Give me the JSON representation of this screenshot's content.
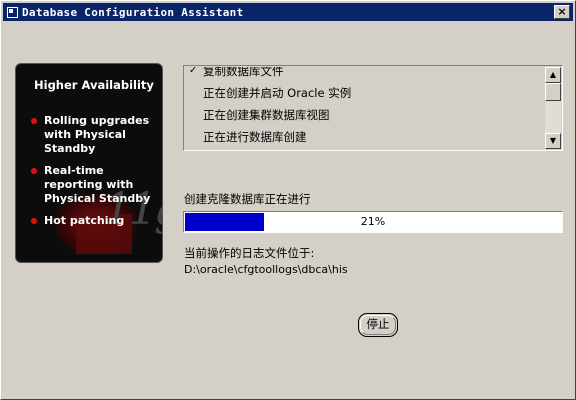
{
  "window": {
    "title": "Database Configuration Assistant",
    "close_glyph": "×"
  },
  "promo": {
    "title": "Higher Availability",
    "items": [
      "Rolling upgrades with Physical Standby",
      "Real-time reporting with Physical Standby",
      "Hot patching"
    ],
    "watermark": "11g"
  },
  "steps": {
    "items": [
      {
        "label": "复制数据库文件",
        "status": "completed",
        "check": "✓"
      },
      {
        "label": "正在创建并启动 Oracle 实例",
        "status": "pending"
      },
      {
        "label": "正在创建集群数据库视图",
        "status": "pending"
      },
      {
        "label": "正在进行数据库创建",
        "status": "pending"
      }
    ]
  },
  "progress": {
    "label": "创建克隆数据库正在进行",
    "percent": 21,
    "percent_text": "21%",
    "fill_color": "#0000cc"
  },
  "log": {
    "label": "当前操作的日志文件位于:",
    "path": "D:\\oracle\\cfgtoollogs\\dbca\\his"
  },
  "buttons": {
    "stop": "停止"
  },
  "icons": {
    "title": "app-icon",
    "close": "close-icon",
    "scroll_up": "scroll-up-icon",
    "scroll_down": "scroll-down-icon",
    "bullet": "red-bullet-icon",
    "check": "check-icon"
  }
}
